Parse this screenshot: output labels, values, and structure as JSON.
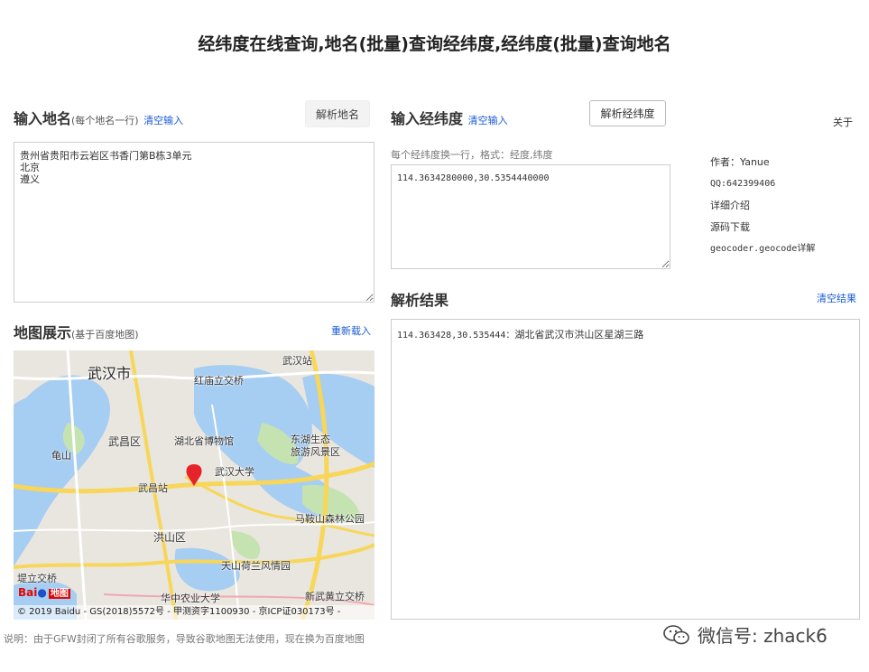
{
  "page": {
    "title": "经纬度在线查询,地名(批量)查询经纬度,经纬度(批量)查询地名"
  },
  "address_panel": {
    "heading": "输入地名",
    "heading_sub": "(每个地名一行)",
    "clear_label": "清空输入",
    "parse_button": "解析地名",
    "input_value": "贵州省贵阳市云岩区书香门第B栋3单元\n北京\n遵义"
  },
  "coord_panel": {
    "heading": "输入经纬度",
    "clear_label": "清空输入",
    "parse_button": "解析经纬度",
    "hint": "每个经纬度换一行，格式：经度,纬度",
    "input_value": "114.3634280000,30.5354440000"
  },
  "about": {
    "label": "关于",
    "author": "作者：Yanue",
    "qq": "QQ:642399406",
    "intro": "详细介绍",
    "source": "源码下载",
    "api": "geocoder.geocode详解"
  },
  "result_panel": {
    "heading": "解析结果",
    "clear_label": "清空结果",
    "lines": [
      {
        "coords": "114.363428,30.535444：",
        "address": "湖北省武汉市洪山区星湖三路"
      }
    ]
  },
  "map_panel": {
    "heading": "地图展示",
    "heading_sub": "(基于百度地图)",
    "reload_label": "重新载入",
    "labels": {
      "wuhan": "武汉市",
      "wuchang_district": "武昌区",
      "hongshan_district": "洪山区",
      "wuchang_station": "武昌站",
      "hubei_museum": "湖北省博物馆",
      "whu": "武汉大学",
      "donghu": "东湖生态",
      "donghu2": "旅游风景区",
      "hongmiao": "红庙立交桥",
      "wuhan_station": "武汉站",
      "guishan": "龟山",
      "maanshan": "马鞍山森林公园",
      "tianshan": "天山荷兰风情园",
      "huanong": "华中农业大学",
      "xinwuhuang": "新武黄立交桥",
      "tidi": "堤立交桥",
      "baidu_text": "Bai",
      "baidu_map": "地图"
    },
    "copyright": "© 2019 Baidu - GS(2018)5572号 - 甲测资字1100930 - 京ICP证030173号 -"
  },
  "footer": {
    "note": "说明：由于GFW封闭了所有谷歌服务，导致谷歌地图无法使用，现在换为百度地图",
    "wechat": "微信号: zhack6"
  },
  "colors": {
    "link": "#1a5bd6",
    "marker": "#e8222a",
    "water": "#a6cdf2",
    "park": "#c5e3b1",
    "road_major": "#f7d65a"
  }
}
